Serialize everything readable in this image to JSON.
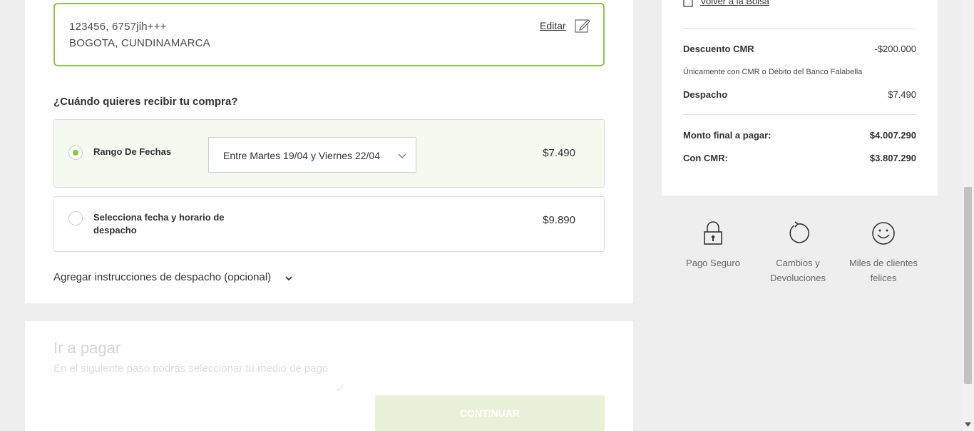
{
  "address": {
    "line1": "123456, 6757jih+++",
    "line2": "BOGOTA, CUNDINAMARCA",
    "edit_label": "Editar"
  },
  "delivery": {
    "title": "¿Cuándo quieres recibir tu compra?",
    "options": [
      {
        "label": "Rango De Fechas",
        "selected_range": "Entre Martes 19/04 y Viernes 22/04",
        "price": "$7.490",
        "selected": true
      },
      {
        "label": "Selecciona fecha y horario de despacho",
        "price": "$9.890",
        "selected": false
      }
    ],
    "instructions_label": "Agregar instrucciones de despacho (opcional)"
  },
  "payment": {
    "title": "Ir a pagar",
    "subtitle": "En el siguiente paso podrás seleccionar tu medio de pago",
    "continue_label": "CONTINUAR"
  },
  "summary": {
    "back_label": "Volver a la Bolsa",
    "discount_label": "Descuento CMR",
    "discount_value": "-$200.000",
    "discount_note": "Únicamente con CMR o Débito del Banco Falabella",
    "shipping_label": "Despacho",
    "shipping_value": "$7.490",
    "total_label": "Monto final a pagar:",
    "total_value": "$4.007.290",
    "cmr_label": "Con CMR:",
    "cmr_value": "$3.807.290"
  },
  "trust": {
    "secure_label": "Pago Seguro",
    "returns_label": "Cambios y Devoluciones",
    "happy_label": "Miles de clientes felices"
  },
  "colors": {
    "accent_green": "#8dc63f",
    "selected_bg": "#f5f9ef",
    "disabled_button": "#e8f1d8"
  },
  "icons": [
    "edit-icon",
    "chevron-down-icon",
    "bag-icon",
    "lock-icon",
    "refresh-icon",
    "smiley-icon",
    "loading-spinner-icon"
  ]
}
